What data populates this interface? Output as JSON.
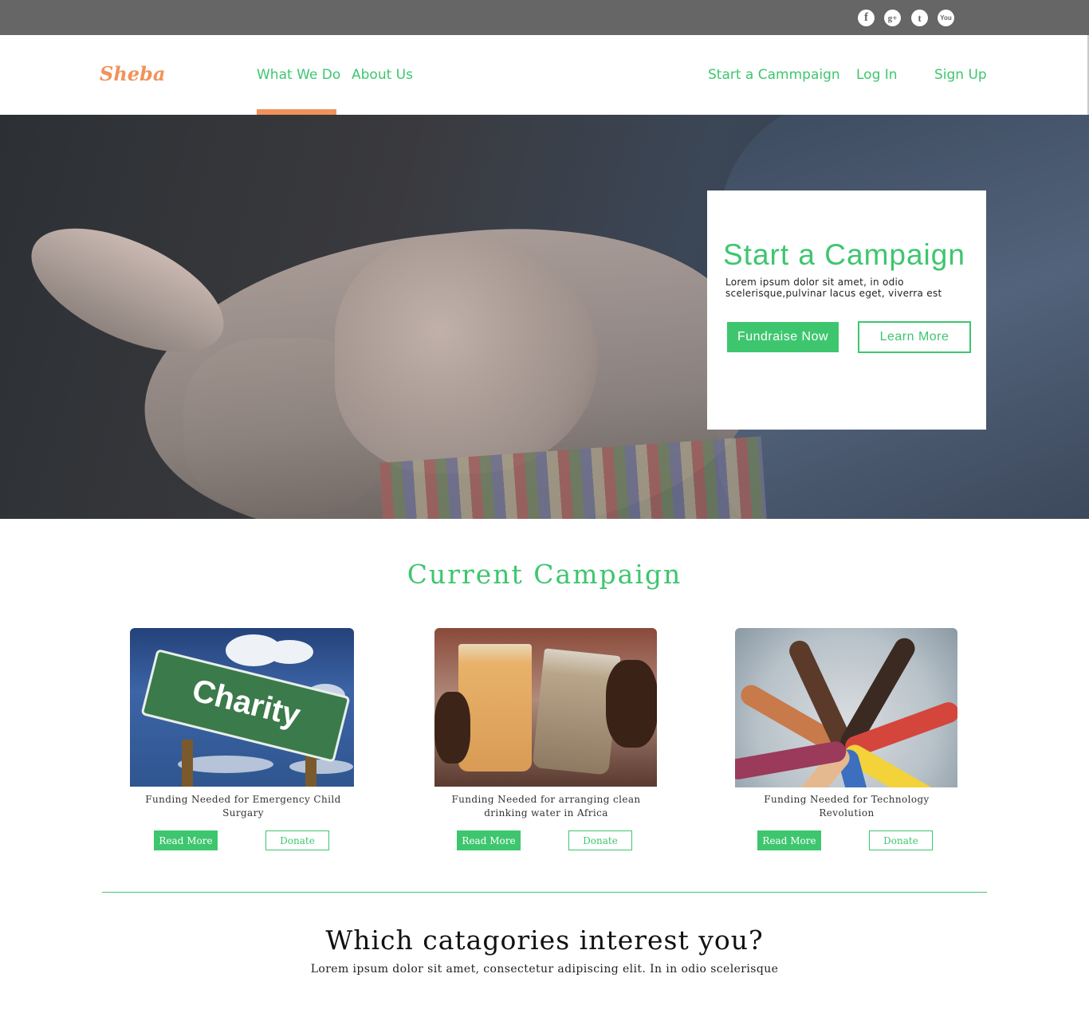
{
  "social": {
    "icons": [
      "facebook-icon",
      "google-plus-icon",
      "twitter-icon",
      "youtube-icon"
    ],
    "facebook_glyph": "f",
    "google_glyph": "g+",
    "twitter_glyph": "t",
    "youtube_glyph": "You"
  },
  "header": {
    "logo": "Sheba",
    "nav_left": [
      "What We Do",
      "About Us"
    ],
    "nav_right": [
      "Start a Cammpaign",
      "Log In",
      "Sign Up"
    ],
    "active_item": "What We Do"
  },
  "hero_card": {
    "title": "Start a Campaign",
    "text": "Lorem ipsum dolor sit amet, in odio scelerisque,pulvinar lacus eget, viverra est",
    "fund_button": "Fundraise Now",
    "learn_button": "Learn More"
  },
  "current_campaign": {
    "title": "Current Campaign",
    "items": [
      {
        "caption": "Funding Needed for Emergency Child Surgary",
        "read_more": "Read More",
        "donate": "Donate",
        "image_text": "Charity"
      },
      {
        "caption": "Funding Needed for arranging clean drinking water in Africa",
        "read_more": "Read More",
        "donate": "Donate"
      },
      {
        "caption": "Funding Needed for Technology Revolution",
        "read_more": "Read More",
        "donate": "Donate"
      }
    ]
  },
  "interests": {
    "title": "Which catagories interest you?",
    "subtitle": "Lorem ipsum dolor sit amet, consectetur adipiscing elit. In in odio scelerisque"
  },
  "colors": {
    "accent_green": "#3ec66f",
    "logo_orange": "#f0935b",
    "topbar_gray": "#666666"
  }
}
